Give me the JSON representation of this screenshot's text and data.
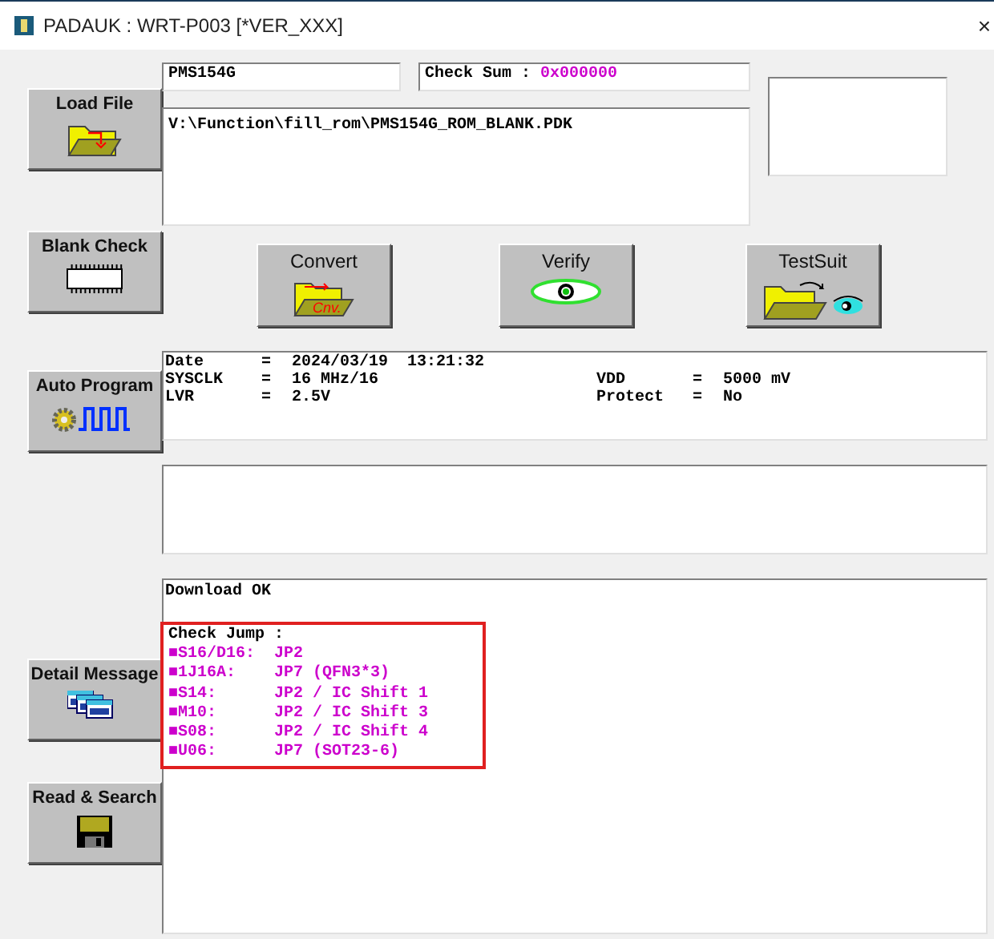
{
  "window": {
    "title": "PADAUK : WRT-P003 [*VER_XXX]",
    "close": "×"
  },
  "side_buttons": [
    {
      "label": "Load File",
      "kind": "folder"
    },
    {
      "label": "Blank Check",
      "kind": "chip"
    },
    {
      "label": "Auto Program",
      "kind": "wave"
    },
    {
      "label": "Detail Message",
      "kind": "windows"
    },
    {
      "label": "Read & Search",
      "kind": "disk"
    }
  ],
  "ic_name": "PMS154G",
  "checksum": {
    "label": "Check Sum :",
    "value": "0x000000"
  },
  "file_path": "V:\\Function\\fill_rom\\PMS154G_ROM_BLANK.PDK",
  "action_buttons": [
    {
      "label": "Convert",
      "kind": "convert",
      "icon_text": "Cnv."
    },
    {
      "label": "Verify",
      "kind": "eye"
    },
    {
      "label": "TestSuit",
      "kind": "testsuit"
    }
  ],
  "info": [
    {
      "label": "Date",
      "eq": "=",
      "value": "2024/03/19  13:21:32"
    },
    {
      "label": "SYSCLK",
      "eq": "=",
      "value": "16 MHz/16",
      "label2": "VDD",
      "eq2": "=",
      "value2": "5000 mV"
    },
    {
      "label": "LVR",
      "eq": "=",
      "value": "2.5V",
      "label2": "Protect",
      "eq2": "=",
      "value2": "No"
    }
  ],
  "message": {
    "status": "Download OK",
    "highlight": [
      {
        "key": "Check Jump",
        "value": ":",
        "color": "#000000"
      },
      {
        "key": "■S16/D16:",
        "value": "JP2",
        "color": "#cc00cc"
      },
      {
        "key": "■1J16A:",
        "value": "JP7 (QFN3*3)",
        "color": "#cc00cc"
      },
      {
        "key": "■S14:",
        "value": "JP2 / IC Shift 1",
        "color": "#cc00cc"
      },
      {
        "key": "■M10:",
        "value": "JP2 / IC Shift 3",
        "color": "#cc00cc"
      },
      {
        "key": "■S08:",
        "value": "JP2 / IC Shift 4",
        "color": "#cc00cc"
      },
      {
        "key": "■U06:",
        "value": "JP7 (SOT23-6)",
        "color": "#cc00cc"
      }
    ]
  }
}
